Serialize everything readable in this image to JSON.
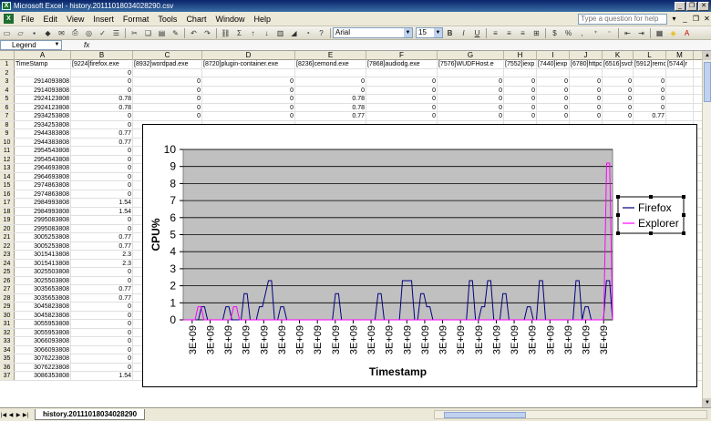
{
  "window": {
    "title": "Microsoft Excel - history.20111018034028290.csv"
  },
  "menubar": {
    "items": [
      "File",
      "Edit",
      "View",
      "Insert",
      "Format",
      "Tools",
      "Chart",
      "Window",
      "Help"
    ],
    "help_placeholder": "Type a question for help"
  },
  "toolbar": {
    "font_name": "Arial",
    "font_size": "15"
  },
  "namebox": {
    "value": "Legend"
  },
  "columns": [
    {
      "letter": "A",
      "header": "TimeStamp"
    },
    {
      "letter": "B",
      "header": "[9224]firefox.exe"
    },
    {
      "letter": "C",
      "header": "[8932]wordpad.exe"
    },
    {
      "letter": "D",
      "header": "[8720]plugin-container.exe"
    },
    {
      "letter": "E",
      "header": "[8236]cemond.exe"
    },
    {
      "letter": "F",
      "header": "[7868]audiodg.exe"
    },
    {
      "letter": "G",
      "header": "[7576]WUDFHost.e"
    },
    {
      "letter": "H",
      "header": "[7552]iexp"
    },
    {
      "letter": "I",
      "header": "[7440]iexp"
    },
    {
      "letter": "J",
      "header": "[6780]httpd"
    },
    {
      "letter": "K",
      "header": "[6516]svch"
    },
    {
      "letter": "L",
      "header": "[5912]remc"
    },
    {
      "letter": "M",
      "header": "[5744]r"
    }
  ],
  "rows": [
    {
      "n": "2",
      "cells": [
        "",
        "0",
        "",
        "",
        "",
        "",
        "",
        "",
        "",
        "",
        "",
        "",
        ""
      ]
    },
    {
      "n": "3",
      "cells": [
        "2914093808",
        "0",
        "0",
        "0",
        "0",
        "0",
        "0",
        "0",
        "0",
        "0",
        "0",
        "0",
        ""
      ]
    },
    {
      "n": "4",
      "cells": [
        "2914093808",
        "0",
        "0",
        "0",
        "0",
        "0",
        "0",
        "0",
        "0",
        "0",
        "0",
        "0",
        ""
      ]
    },
    {
      "n": "5",
      "cells": [
        "2924123808",
        "0.78",
        "0",
        "0",
        "0.78",
        "0",
        "0",
        "0",
        "0",
        "0",
        "0",
        "0",
        ""
      ]
    },
    {
      "n": "6",
      "cells": [
        "2924123808",
        "0.78",
        "0",
        "0",
        "0.78",
        "0",
        "0",
        "0",
        "0",
        "0",
        "0",
        "0",
        ""
      ]
    },
    {
      "n": "7",
      "cells": [
        "2934253808",
        "0",
        "0",
        "0",
        "0.77",
        "0",
        "0",
        "0",
        "0",
        "0",
        "0",
        "0.77",
        ""
      ]
    },
    {
      "n": "8",
      "cells": [
        "2934253808",
        "0",
        "",
        "",
        "",
        "",
        "",
        "",
        "",
        "",
        "",
        "",
        ""
      ]
    },
    {
      "n": "9",
      "cells": [
        "2944383808",
        "0.77",
        "",
        "",
        "",
        "",
        "",
        "",
        "",
        "",
        "",
        "",
        ""
      ]
    },
    {
      "n": "10",
      "cells": [
        "2944383808",
        "0.77",
        "",
        "",
        "",
        "",
        "",
        "",
        "",
        "",
        "",
        "",
        ""
      ]
    },
    {
      "n": "11",
      "cells": [
        "2954543808",
        "0",
        "",
        "",
        "",
        "",
        "",
        "",
        "",
        "",
        "",
        "",
        ""
      ]
    },
    {
      "n": "12",
      "cells": [
        "2954543808",
        "0",
        "",
        "",
        "",
        "",
        "",
        "",
        "",
        "",
        "",
        "",
        ""
      ]
    },
    {
      "n": "13",
      "cells": [
        "2964693808",
        "0",
        "",
        "",
        "",
        "",
        "",
        "",
        "",
        "",
        "",
        "",
        ""
      ]
    },
    {
      "n": "14",
      "cells": [
        "2964693808",
        "0",
        "",
        "",
        "",
        "",
        "",
        "",
        "",
        "",
        "",
        "",
        ""
      ]
    },
    {
      "n": "15",
      "cells": [
        "2974863808",
        "0",
        "",
        "",
        "",
        "",
        "",
        "",
        "",
        "",
        "",
        "",
        ""
      ]
    },
    {
      "n": "16",
      "cells": [
        "2974863808",
        "0",
        "",
        "",
        "",
        "",
        "",
        "",
        "",
        "",
        "",
        "",
        ""
      ]
    },
    {
      "n": "17",
      "cells": [
        "2984993808",
        "1.54",
        "",
        "",
        "",
        "",
        "",
        "",
        "",
        "",
        "",
        "",
        ""
      ]
    },
    {
      "n": "18",
      "cells": [
        "2984993808",
        "1.54",
        "",
        "",
        "",
        "",
        "",
        "",
        "",
        "",
        "",
        "",
        ""
      ]
    },
    {
      "n": "19",
      "cells": [
        "2995083808",
        "0",
        "",
        "",
        "",
        "",
        "",
        "",
        "",
        "",
        "",
        "",
        ""
      ]
    },
    {
      "n": "20",
      "cells": [
        "2995083808",
        "0",
        "",
        "",
        "",
        "",
        "",
        "",
        "",
        "",
        "",
        "",
        ""
      ]
    },
    {
      "n": "21",
      "cells": [
        "3005253808",
        "0.77",
        "",
        "",
        "",
        "",
        "",
        "",
        "",
        "",
        "",
        "",
        ""
      ]
    },
    {
      "n": "22",
      "cells": [
        "3005253808",
        "0.77",
        "",
        "",
        "",
        "",
        "",
        "",
        "",
        "",
        "",
        "",
        ""
      ]
    },
    {
      "n": "23",
      "cells": [
        "3015413808",
        "2.3",
        "",
        "",
        "",
        "",
        "",
        "",
        "",
        "",
        "",
        "",
        ""
      ]
    },
    {
      "n": "24",
      "cells": [
        "3015413808",
        "2.3",
        "",
        "",
        "",
        "",
        "",
        "",
        "",
        "",
        "",
        "",
        ""
      ]
    },
    {
      "n": "25",
      "cells": [
        "3025503808",
        "0",
        "",
        "",
        "",
        "",
        "",
        "",
        "",
        "",
        "",
        "",
        ""
      ]
    },
    {
      "n": "26",
      "cells": [
        "3025503808",
        "0",
        "",
        "",
        "",
        "",
        "",
        "",
        "",
        "",
        "",
        "",
        ""
      ]
    },
    {
      "n": "27",
      "cells": [
        "3035653808",
        "0.77",
        "",
        "",
        "",
        "",
        "",
        "",
        "",
        "",
        "",
        "",
        ""
      ]
    },
    {
      "n": "28",
      "cells": [
        "3035653808",
        "0.77",
        "",
        "",
        "",
        "",
        "",
        "",
        "",
        "",
        "",
        "",
        ""
      ]
    },
    {
      "n": "29",
      "cells": [
        "3045823808",
        "0",
        "",
        "",
        "",
        "",
        "",
        "",
        "",
        "",
        "",
        "",
        ""
      ]
    },
    {
      "n": "30",
      "cells": [
        "3045823808",
        "0",
        "",
        "",
        "",
        "",
        "",
        "",
        "",
        "",
        "",
        "",
        ""
      ]
    },
    {
      "n": "31",
      "cells": [
        "3055953808",
        "0",
        "",
        "",
        "",
        "",
        "",
        "",
        "",
        "",
        "",
        "",
        ""
      ]
    },
    {
      "n": "32",
      "cells": [
        "3055953808",
        "0",
        "",
        "",
        "",
        "",
        "",
        "",
        "",
        "",
        "",
        "",
        ""
      ]
    },
    {
      "n": "33",
      "cells": [
        "3066093808",
        "0",
        "",
        "",
        "",
        "",
        "",
        "",
        "",
        "",
        "",
        "",
        ""
      ]
    },
    {
      "n": "34",
      "cells": [
        "3066093808",
        "0",
        "",
        "",
        "",
        "",
        "",
        "",
        "",
        "",
        "",
        "",
        ""
      ]
    },
    {
      "n": "35",
      "cells": [
        "3076223808",
        "0",
        "0",
        "0",
        "0.77",
        "0",
        "0",
        "0",
        "0",
        "0",
        "0",
        "0",
        ""
      ]
    },
    {
      "n": "36",
      "cells": [
        "3076223808",
        "0",
        "0",
        "0",
        "0.77",
        "0",
        "0",
        "0",
        "0",
        "0",
        "0",
        "0",
        ""
      ]
    },
    {
      "n": "37",
      "cells": [
        "3086353808",
        "1.54",
        "0",
        "0",
        "0.77",
        "0",
        "0",
        "0",
        "0",
        "0",
        "0",
        "0",
        ""
      ]
    }
  ],
  "sheet_tab": "history.20111018034028290",
  "chart_data": {
    "type": "line",
    "xlabel": "Timestamp",
    "ylabel": "CPU%",
    "ylim": [
      0,
      10
    ],
    "yticks": [
      0,
      1,
      2,
      3,
      4,
      5,
      6,
      7,
      8,
      9,
      10
    ],
    "xtick_label": "3E+09",
    "xtick_count": 24,
    "grid": true,
    "legend_position": "right",
    "plot_background": "#c0c0c0",
    "series": [
      {
        "name": "Firefox",
        "color": "#000080",
        "values": [
          0,
          0,
          0,
          0,
          0,
          0,
          0.77,
          0.77,
          0,
          0,
          0,
          0,
          0,
          0,
          0.77,
          0.77,
          0,
          0,
          0,
          0,
          1.54,
          1.54,
          0,
          0,
          0,
          0.77,
          0.77,
          1.54,
          2.3,
          2.3,
          0,
          0,
          0.77,
          0.77,
          0,
          0,
          0,
          0,
          0,
          0,
          0,
          0,
          0,
          0,
          0,
          0,
          0,
          0,
          0,
          0,
          1.54,
          1.54,
          0,
          0,
          0,
          0,
          0,
          0,
          0,
          0,
          0,
          0,
          0,
          0,
          1.54,
          1.54,
          0,
          0,
          0,
          0,
          0,
          0,
          2.3,
          2.3,
          2.3,
          2.3,
          0,
          0,
          1.54,
          1.54,
          0.77,
          0.77,
          0,
          0,
          0,
          0,
          0,
          0,
          0,
          0,
          0,
          0,
          0,
          0,
          2.3,
          2.3,
          0,
          0,
          0.77,
          0.77,
          2.3,
          2.3,
          0,
          0,
          0,
          1.54,
          1.54,
          0,
          0,
          0,
          0,
          0,
          0,
          0.77,
          0.77,
          0,
          0,
          2.3,
          2.3,
          0,
          0,
          0,
          0,
          0,
          0,
          0,
          0,
          0,
          0,
          2.3,
          2.3,
          0,
          0.77,
          0.77,
          0,
          0,
          0,
          0,
          0,
          2.3,
          2.3,
          0
        ]
      },
      {
        "name": "Explorer",
        "color": "#ff00ff",
        "values": [
          0,
          0,
          0,
          0,
          0,
          0.77,
          0.77,
          0,
          0,
          0,
          0,
          0,
          0,
          0,
          0,
          0,
          0,
          0.77,
          0.77,
          0,
          0,
          0,
          0,
          0,
          0,
          0,
          0,
          0,
          0,
          0,
          0,
          0,
          0,
          0,
          0,
          0,
          0,
          0,
          0,
          0,
          0,
          0,
          0,
          0,
          0,
          0,
          0,
          0,
          0,
          0,
          0,
          0,
          0,
          0,
          0,
          0,
          0,
          0,
          0,
          0,
          0,
          0,
          0,
          0,
          0,
          0,
          0,
          0,
          0,
          0,
          0,
          0,
          0,
          0,
          0,
          0,
          0,
          0,
          0,
          0,
          0,
          0,
          0,
          0,
          0,
          0,
          0,
          0,
          0,
          0,
          0,
          0,
          0,
          0,
          0,
          0,
          0,
          0,
          0,
          0,
          0,
          0,
          0,
          0,
          0,
          0,
          0,
          0,
          0,
          0,
          0,
          0,
          0,
          0,
          0,
          0,
          0,
          0,
          0,
          0,
          0,
          0,
          0,
          0,
          0,
          0,
          0,
          0,
          0,
          0,
          0,
          0,
          0,
          0,
          0,
          0,
          0,
          0,
          0,
          0,
          0,
          0,
          0,
          9.2,
          9.2,
          0
        ]
      }
    ]
  }
}
